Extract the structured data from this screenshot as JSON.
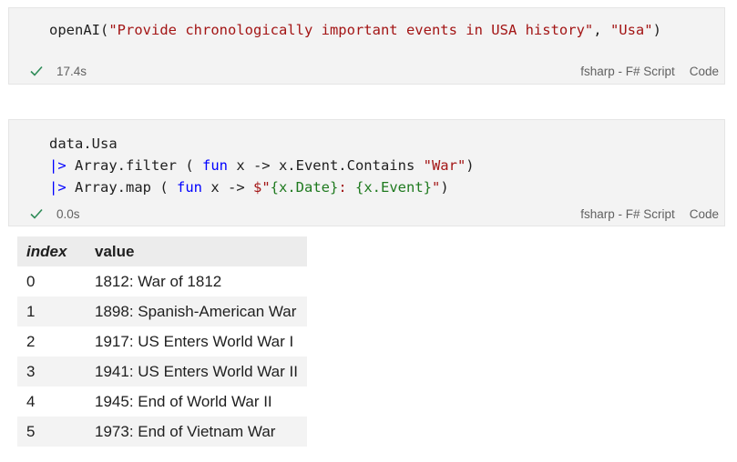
{
  "cell1": {
    "code": {
      "fn": "openAI",
      "open": "(",
      "arg1": "\"Provide chronologically important events in USA history\"",
      "sep": ", ",
      "arg2": "\"Usa\"",
      "close": ")"
    },
    "status": {
      "duration": "17.4s",
      "language": "fsharp - F# Script",
      "kind": "Code"
    }
  },
  "cell2": {
    "code": {
      "line1": "data.Usa",
      "pipe": "|>",
      "filter_fn": " Array.filter ( ",
      "fun_kw": "fun",
      "filter_body": " x -> x.Event.Contains ",
      "filter_str": "\"War\"",
      "filter_close": ")",
      "map_fn": " Array.map ( ",
      "map_body": " x -> ",
      "interp_start": "$\"",
      "interp_date": "{x.Date}",
      "interp_sep": ": ",
      "interp_event": "{x.Event}",
      "interp_end": "\"",
      "map_close": ")"
    },
    "status": {
      "duration": "0.0s",
      "language": "fsharp - F# Script",
      "kind": "Code"
    }
  },
  "output": {
    "headers": {
      "index": "index",
      "value": "value"
    },
    "rows": [
      {
        "index": "0",
        "value": "1812: War of 1812"
      },
      {
        "index": "1",
        "value": "1898: Spanish-American War"
      },
      {
        "index": "2",
        "value": "1917: US Enters World War I"
      },
      {
        "index": "3",
        "value": "1941: US Enters World War II"
      },
      {
        "index": "4",
        "value": "1945: End of World War II"
      },
      {
        "index": "5",
        "value": "1973: End of Vietnam War"
      }
    ]
  },
  "colors": {
    "success_check": "#2e8b57",
    "keyword": "#0000ff",
    "string": "#a31515",
    "interpolation": "#1f7a1f"
  },
  "icons": {
    "status": "check-icon"
  }
}
